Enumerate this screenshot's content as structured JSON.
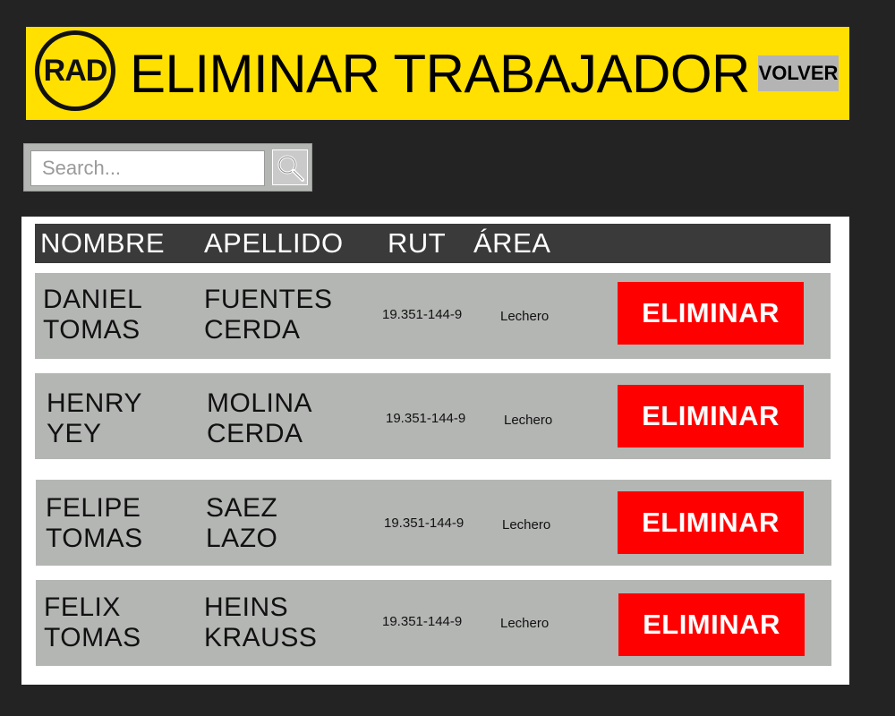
{
  "header": {
    "logo_text": "RAD",
    "title": "ELIMINAR TRABAJADOR",
    "back_label": "VOLVER",
    "background": "#ffe000"
  },
  "search": {
    "placeholder": "Search...",
    "value": "",
    "icon": "magnifier-icon"
  },
  "table": {
    "columns": [
      "NOMBRE",
      "APELLIDO",
      "RUT",
      "ÁREA"
    ],
    "rows": [
      {
        "first": "DANIEL",
        "second": "TOMAS",
        "last1": "FUENTES",
        "last2": "CERDA",
        "rut": "19.351-144-9",
        "area": "Lechero",
        "action": "ELIMINAR"
      },
      {
        "first": "HENRY",
        "second": "YEY",
        "last1": "MOLINA",
        "last2": "CERDA",
        "rut": "19.351-144-9",
        "area": "Lechero",
        "action": "ELIMINAR"
      },
      {
        "first": "FELIPE",
        "second": "TOMAS",
        "last1": "SAEZ",
        "last2": "LAZO",
        "rut": "19.351-144-9",
        "area": "Lechero",
        "action": "ELIMINAR"
      },
      {
        "first": "FELIX",
        "second": "TOMAS",
        "last1": "HEINS",
        "last2": "KRAUSS",
        "rut": "19.351-144-9",
        "area": "Lechero",
        "action": "ELIMINAR"
      }
    ]
  },
  "colors": {
    "page_bg": "#232323",
    "accent": "#ffe000",
    "danger": "#ff0000",
    "row_bg": "#b4b6b4",
    "table_header_bg": "#3a3a3a"
  }
}
